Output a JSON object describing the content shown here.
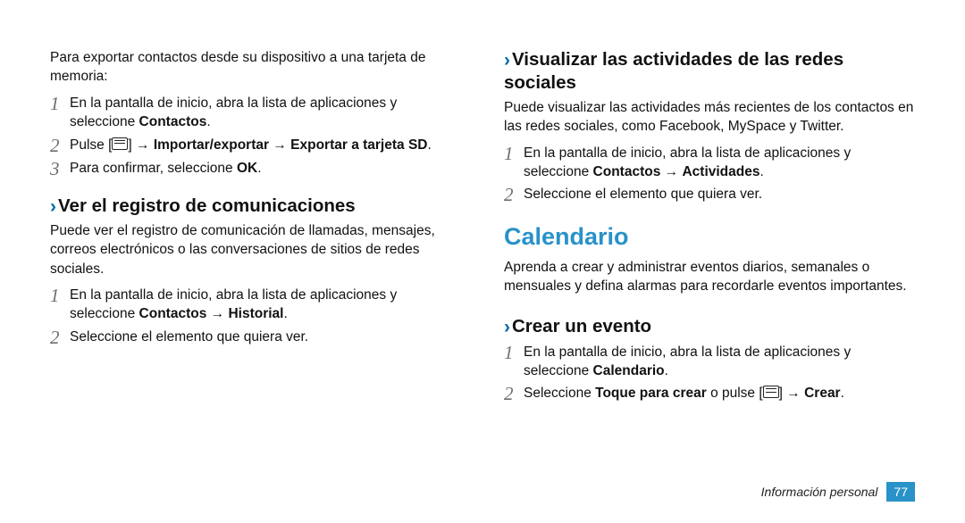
{
  "left": {
    "intro": "Para exportar contactos desde su dispositivo a una tarjeta de memoria:",
    "step1": [
      "En la pantalla de inicio, abra la lista de aplicaciones y seleccione ",
      "Contactos",
      "."
    ],
    "step2": [
      "Pulse [",
      "icon",
      "] → ",
      "Importar/exportar",
      " → ",
      "Exportar a tarjeta SD",
      "."
    ],
    "step3": [
      "Para confirmar, seleccione ",
      "OK",
      "."
    ],
    "h_reg": "Ver el registro de comunicaciones",
    "p_reg": "Puede ver el registro de comunicación de llamadas, mensajes, correos electrónicos o las conversaciones de sitios de redes sociales.",
    "reg_step1": [
      "En la pantalla de inicio, abra la lista de aplicaciones y seleccione ",
      "Contactos",
      " → ",
      "Historial",
      "."
    ],
    "reg_step2": "Seleccione el elemento que quiera ver."
  },
  "right": {
    "h_soc": "Visualizar las actividades de las redes sociales",
    "p_soc": "Puede visualizar las actividades más recientes de los contactos en las redes sociales, como Facebook, MySpace y Twitter.",
    "soc_step1": [
      "En la pantalla de inicio, abra la lista de aplicaciones y seleccione ",
      "Contactos",
      " → ",
      "Actividades",
      "."
    ],
    "soc_step2": "Seleccione el elemento que quiera ver.",
    "h_cal": "Calendario",
    "p_cal": "Aprenda a crear y administrar eventos diarios, semanales o mensuales y defina alarmas para recordarle eventos importantes.",
    "h_ev": "Crear un evento",
    "ev_step1": [
      "En la pantalla de inicio, abra la lista de aplicaciones y seleccione ",
      "Calendario",
      "."
    ],
    "ev_step2": [
      "Seleccione ",
      "Toque para crear",
      " o pulse [",
      "icon",
      "] → ",
      "Crear",
      "."
    ]
  },
  "footer": {
    "label": "Información personal",
    "page": "77"
  },
  "glyphs": {
    "chev": "›",
    "n1": "1",
    "n2": "2",
    "n3": "3"
  }
}
